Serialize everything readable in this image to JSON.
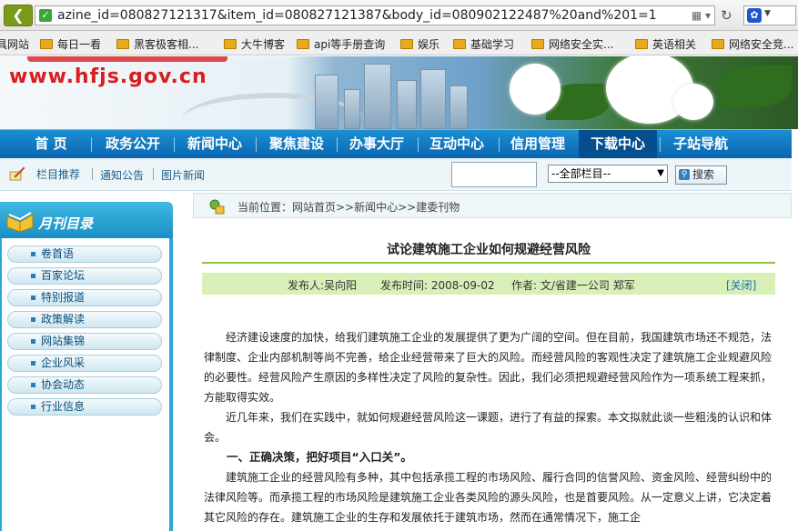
{
  "browser": {
    "url": "azine_id=080827121317&item_id=080827121387&body_id=080902122487%20and%201=1",
    "bookmarks": [
      "具网站",
      "每日一看",
      "黑客极客相...",
      "大牛博客",
      "api等手册查询",
      "娱乐",
      "基础学习",
      "网络安全实...",
      "英语相关",
      "网络安全竞..."
    ]
  },
  "banner": {
    "site": "www.hfjs.gov.cn"
  },
  "nav": {
    "items": [
      "首  页",
      "政务公开",
      "新闻中心",
      "聚焦建设",
      "办事大厅",
      "互动中心",
      "信用管理",
      "下载中心",
      "子站导航"
    ],
    "active_index": 7
  },
  "subnav": {
    "label": "栏目推荐",
    "links": [
      "通知公告",
      "图片新闻"
    ],
    "search_value": "",
    "select_value": "--全部栏目--",
    "search_button": "搜索"
  },
  "sidebar": {
    "title": "月刊目录",
    "items": [
      "卷首语",
      "百家论坛",
      "特别报道",
      "政策解读",
      "网站集锦",
      "企业风采",
      "协会动态",
      "行业信息"
    ]
  },
  "content": {
    "breadcrumb": "当前位置：网站首页>>新闻中心>>建委刊物",
    "title": "试论建筑施工企业如何规避经营风险",
    "meta": {
      "publisher": "发布人:吴向阳",
      "time": "发布时间:  2008-09-02",
      "author": "作者:  文/省建一公司  郑军",
      "close": "[关闭]"
    },
    "paragraphs": [
      "经济建设速度的加快，给我们建筑施工企业的发展提供了更为广阔的空间。但在目前，我国建筑市场还不规范，法律制度、企业内部机制等尚不完善，给企业经营带来了巨大的风险。而经营风险的客观性决定了建筑施工企业规避风险的必要性。经营风险产生原因的多样性决定了风险的复杂性。因此，我们必须把规避经营风险作为一项系统工程来抓，方能取得实效。",
      "近几年来，我们在实践中，就如何规避经营风险这一课题，进行了有益的探索。本文拟就此谈一些粗浅的认识和体会。",
      "一、正确决策，把好项目“入口关”。",
      "建筑施工企业的经营风险有多种，其中包括承揽工程的市场风险、履行合同的信誉风险、资金风险、经营纠纷中的法律风险等。而承揽工程的市场风险是建筑施工企业各类风险的源头风险，也是首要风险。从一定意义上讲，它决定着其它风险的存在。建筑施工企业的生存和发展依托于建筑市场，然而在通常情况下，施工企"
    ]
  }
}
